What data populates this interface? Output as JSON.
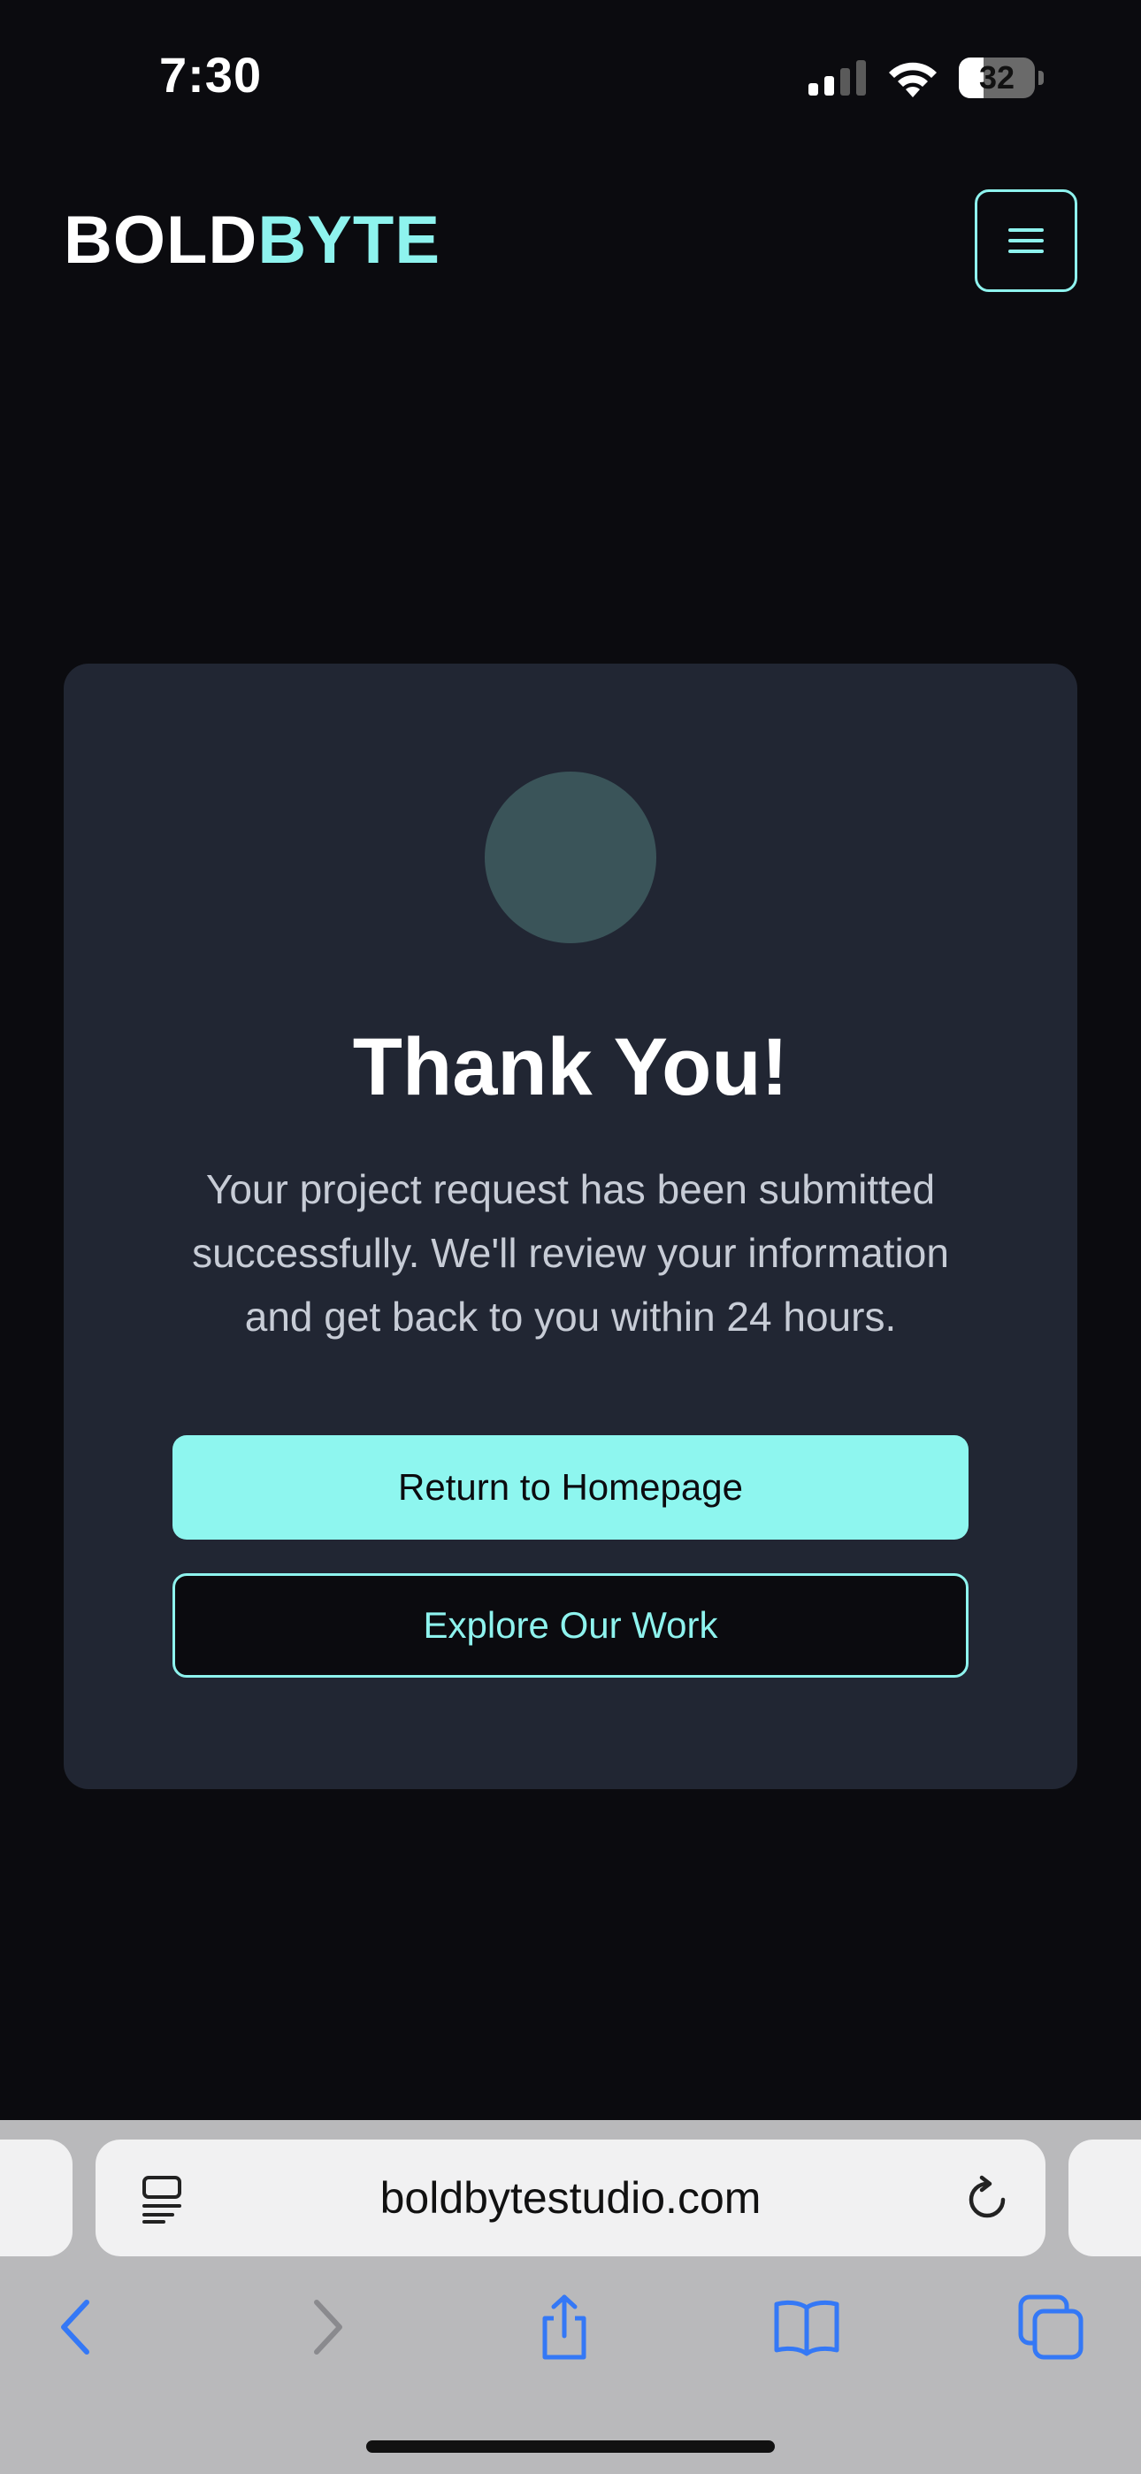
{
  "status_bar": {
    "time": "7:30",
    "battery_level": "32"
  },
  "header": {
    "logo_part1": "BOLD",
    "logo_part2": "BYTE",
    "menu_icon": "hamburger-icon"
  },
  "card": {
    "icon": "success-circle",
    "title": "Thank You!",
    "message": "Your project request has been submitted successfully. We'll review your information and get back to you within 24 hours.",
    "primary_button": "Return to Homepage",
    "secondary_button": "Explore Our Work"
  },
  "browser": {
    "url": "boldbytestudio.com",
    "icons": [
      "reader-icon",
      "reload-icon",
      "back-icon",
      "forward-icon",
      "share-icon",
      "bookmarks-icon",
      "tabs-icon"
    ]
  },
  "colors": {
    "background": "#0b0b0f",
    "card": "#212633",
    "accent": "#8ef3ee",
    "text_muted": "#c7ccd6"
  }
}
